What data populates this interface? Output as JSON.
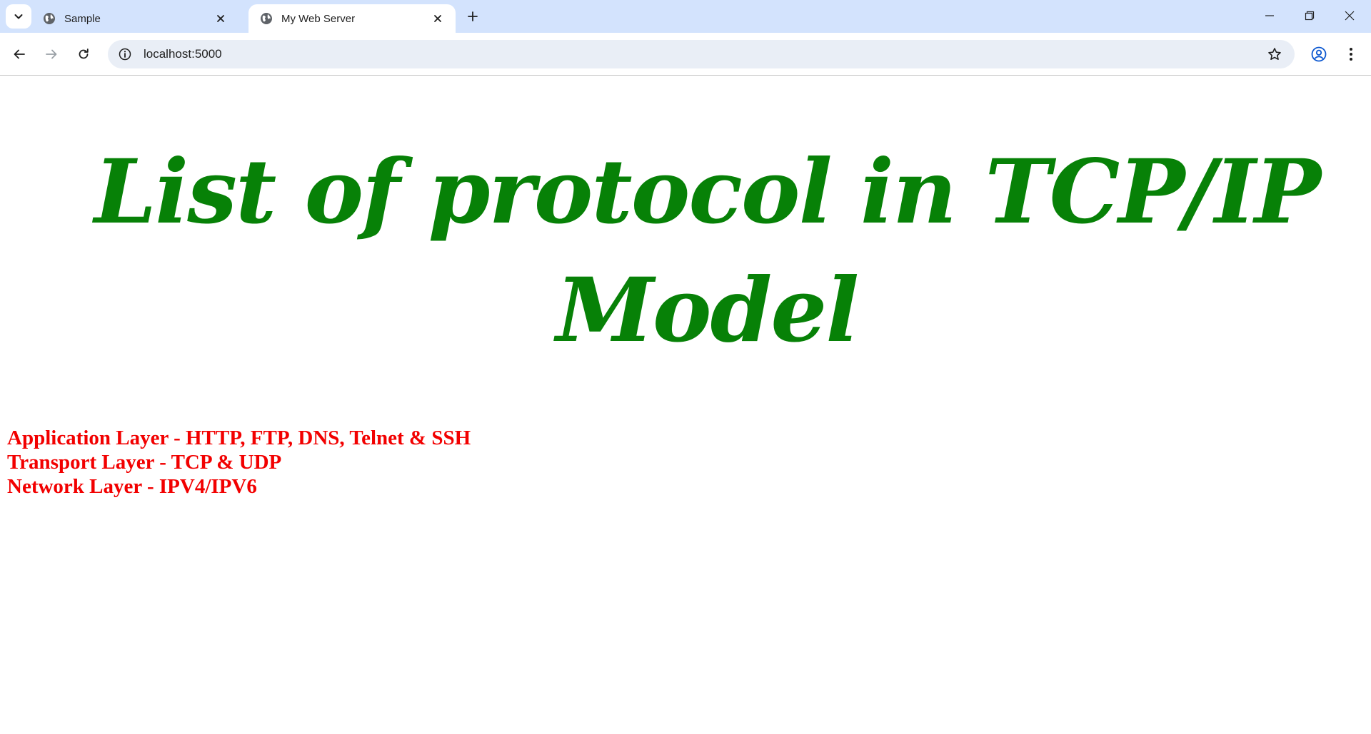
{
  "browser": {
    "tabs": [
      {
        "title": "Sample",
        "active": false
      },
      {
        "title": "My Web Server",
        "active": true
      }
    ],
    "address_bar": {
      "url": "localhost:5000"
    },
    "icons": {
      "tab_search": "chevron-down-icon",
      "favicon": "globe-icon",
      "tab_close": "close-icon",
      "new_tab": "plus-icon",
      "back": "arrow-left-icon",
      "forward": "arrow-right-icon",
      "reload": "reload-icon",
      "site_info": "info-icon",
      "bookmark": "star-icon",
      "profile": "profile-icon",
      "menu": "kebab-menu-icon",
      "minimize": "minimize-icon",
      "restore": "restore-icon",
      "close_window": "close-icon"
    }
  },
  "page": {
    "heading_line1": "List of protocol in TCP/IP",
    "heading_line2": "Model",
    "heading_color": "#078107",
    "protocols": [
      "Application Layer - HTTP, FTP, DNS, Telnet & SSH",
      "Transport Layer - TCP & UDP",
      "Network Layer - IPV4/IPV6"
    ],
    "protocol_color": "#f20000"
  }
}
